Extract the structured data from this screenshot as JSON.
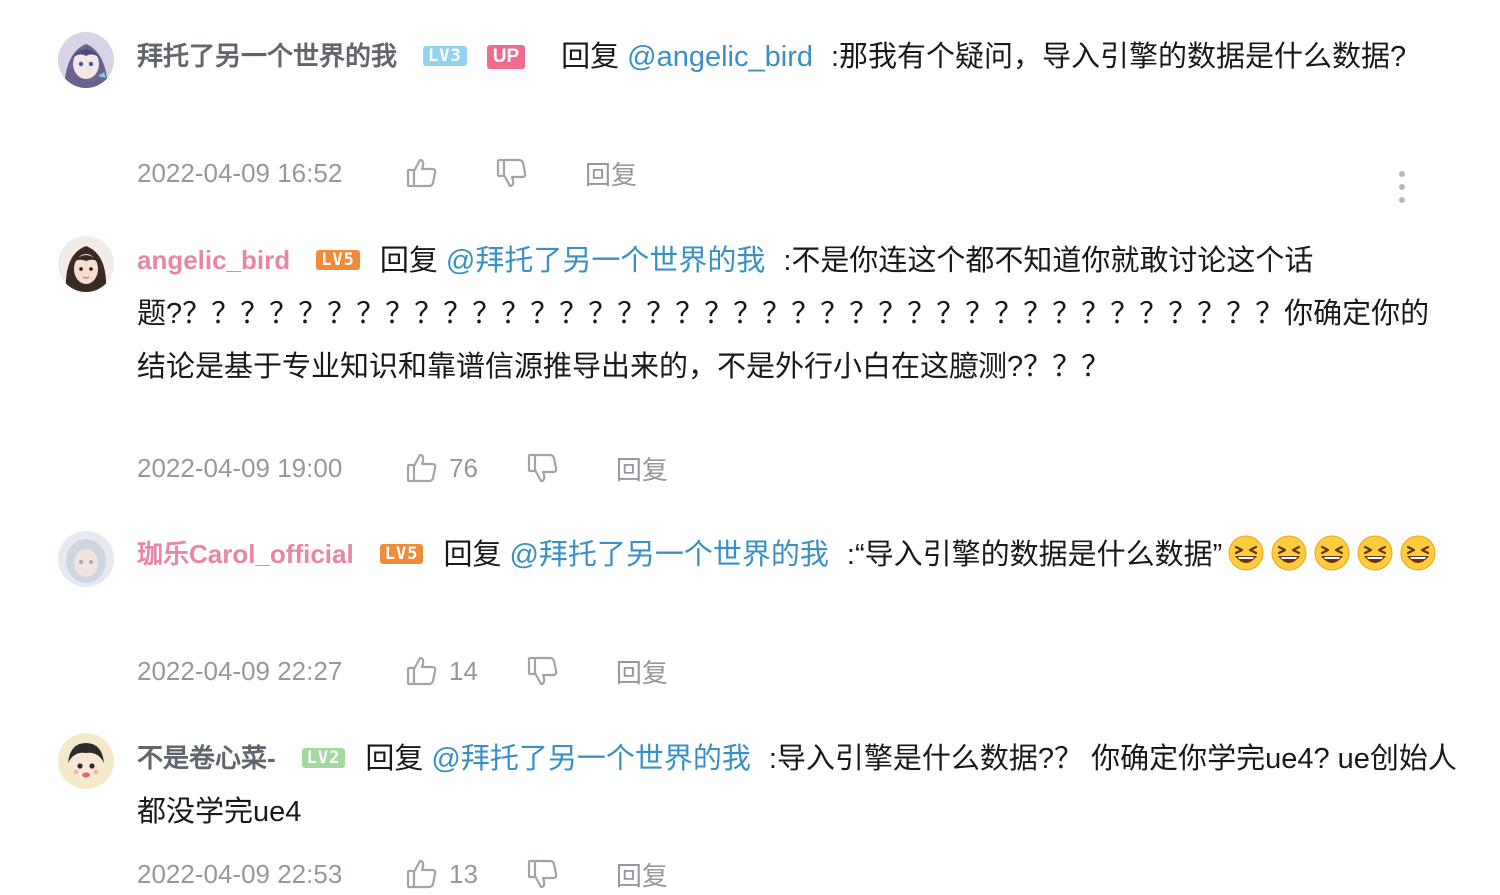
{
  "comments": [
    {
      "username": "拜托了另一个世界的我",
      "level": "LV3",
      "up_badge": "UP",
      "reply_word": "回复",
      "at_user": "@angelic_bird",
      "text": ":那我有个疑问，导入引擎的数据是什么数据?",
      "time": "2022-04-09 16:52",
      "likes": "",
      "reply_label": "回复"
    },
    {
      "username": "angelic_bird",
      "level": "LV5",
      "reply_word": "回复",
      "at_user": "@拜托了另一个世界的我",
      "text": ":不是你连这个都不知道你就敢讨论这个话题?？？？？？？？？？？？？？？？？？？？？？？？？？？？？？？？？？？？？？？你确定你的结论是基于专业知识和靠谱信源推导出来的，不是外行小白在这臆测?？？？",
      "time": "2022-04-09 19:00",
      "likes": "76",
      "reply_label": "回复"
    },
    {
      "username": "珈乐Carol_official",
      "level": "LV5",
      "reply_word": "回复",
      "at_user": "@拜托了另一个世界的我",
      "text": ":“导入引擎的数据是什么数据”",
      "emoji_count": 5,
      "time": "2022-04-09 22:27",
      "likes": "14",
      "reply_label": "回复"
    },
    {
      "username": "不是卷心菜-",
      "level": "LV2",
      "reply_word": "回复",
      "at_user": "@拜托了另一个世界的我",
      "text": ":导入引擎是什么数据?？ 你确定你学完ue4?  ue创始人都没学完ue4",
      "time": "2022-04-09 22:53",
      "likes": "13",
      "reply_label": "回复"
    }
  ],
  "icons": {
    "like": "thumbs-up-icon",
    "dislike": "thumbs-down-icon",
    "more": "more-vertical-icon",
    "emoji": "laughing-emoji"
  },
  "colors": {
    "username_default": "#61666d",
    "username_vip": "#e985a6",
    "link": "#3b8fc7",
    "meta": "#9499a0",
    "up_badge": "#f06b8e"
  }
}
